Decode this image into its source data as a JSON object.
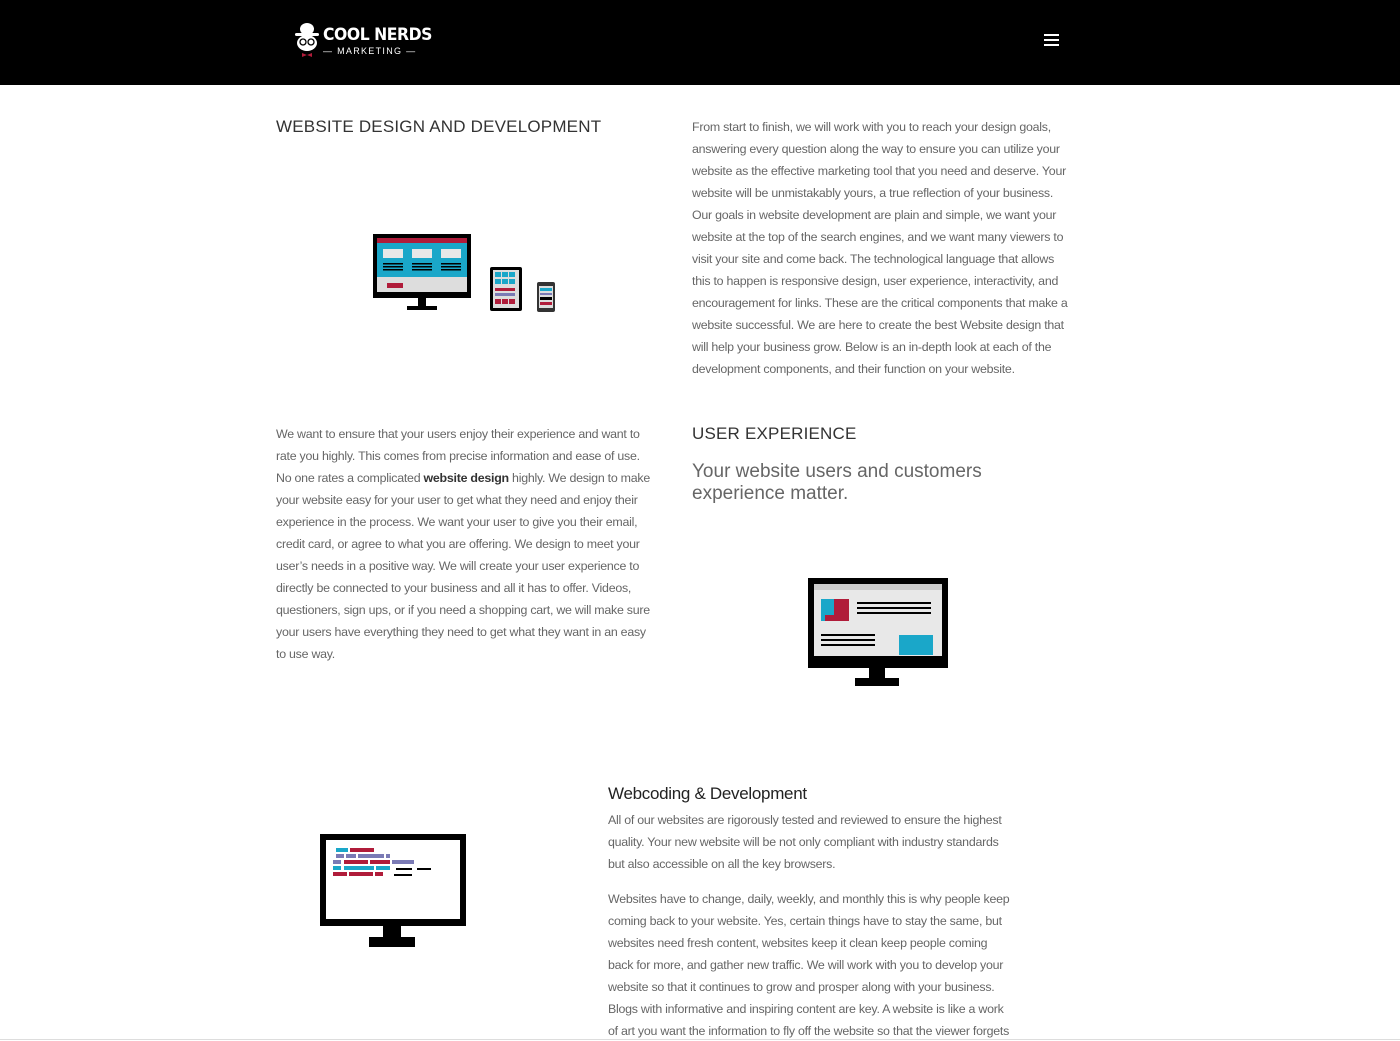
{
  "header": {
    "brand": "COOL NERDS",
    "tagline": "— MARKETING —"
  },
  "section1": {
    "title": "WEBSITE DESIGN AND DEVELOPMENT",
    "body": "From start to finish, we will work with you to reach your design goals, answering every question along the way to ensure you can utilize your website as the effective marketing tool that you need and deserve. Your website will be unmistakably yours, a true reflection of your business. Our goals in website development are plain and simple, we want your website at the top of the search engines, and we want many viewers to visit your site and come back. The technological language that allows this to happen is responsive design, user experience, interactivity, and encouragement for links. These are the critical components that make a website successful. We are here to create the best Website design that will help your business grow. Below is an in-depth look at each of the development components, and their function on your website."
  },
  "section2": {
    "title": "USER EXPERIENCE",
    "lead": "Your website users and customers experience matter.",
    "body_before": "We want to ensure that your users enjoy their experience and want to rate you highly. This comes from precise information and ease of use. No one rates a complicated ",
    "body_bold": "website design",
    "body_after": " highly. We design to make your website easy for your user to get what they need and enjoy their experience in the process. We want your user to give you their email, credit card, or agree to what you are offering. We design to meet your user’s needs in a positive way. We will create your user experience to directly be connected to your business and all it has to offer. Videos, questioners, sign ups, or if you need a shopping cart, we will make sure your users have everything they need to get what they want in an easy to use way."
  },
  "section3": {
    "title": "Webcoding & Development",
    "para1": "All of our websites are rigorously tested and reviewed to ensure the highest quality. Your new website will be not only compliant with industry standards but also accessible on all the key browsers.",
    "para2": "Websites have to change, daily, weekly, and monthly this is why people keep coming back to your website. Yes, certain things have to stay the same, but websites need fresh content, websites keep it clean keep people coming back for more, and gather new traffic. We will work with you to develop your website so that it continues to grow and prosper along with your business. Blogs with informative and inspiring content are key. A website is like a work of art you want the information to fly off the website so that the viewer forgets they are looking at technology and are purely into the content. Art is art when you"
  },
  "colors": {
    "header_bg": "#000000",
    "accent_red": "#b01c3a",
    "accent_cyan": "#1aa7c9"
  }
}
